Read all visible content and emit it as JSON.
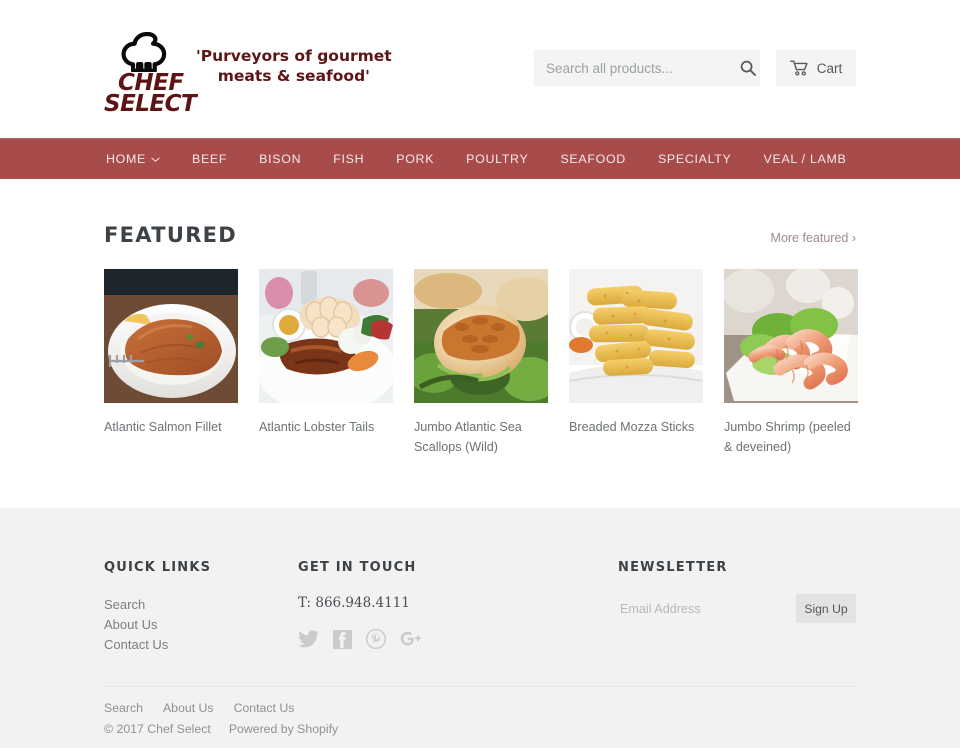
{
  "header": {
    "logo": {
      "line1": "CHEF",
      "line2": "SELECT",
      "tagline_line1": "'Purveyors of gourmet",
      "tagline_line2": "meats & seafood'",
      "hat_icon": "chef-hat-icon",
      "brand_color": "#5e1414"
    },
    "search": {
      "placeholder": "Search all products...",
      "value": "",
      "icon": "search-icon"
    },
    "cart": {
      "label": "Cart",
      "icon": "shopping-cart-icon"
    }
  },
  "nav": {
    "accent_color": "#a84b4b",
    "items": [
      {
        "label": "HOME",
        "has_caret": true,
        "caret_icon": "chevron-down-icon"
      },
      {
        "label": "BEEF",
        "has_caret": false
      },
      {
        "label": "BISON",
        "has_caret": false
      },
      {
        "label": "FISH",
        "has_caret": false
      },
      {
        "label": "PORK",
        "has_caret": false
      },
      {
        "label": "POULTRY",
        "has_caret": false
      },
      {
        "label": "SEAFOOD",
        "has_caret": false
      },
      {
        "label": "SPECIALTY",
        "has_caret": false
      },
      {
        "label": "VEAL / LAMB",
        "has_caret": false
      }
    ]
  },
  "featured": {
    "title": "FEATURED",
    "more_label": "More featured ›",
    "products": [
      {
        "name": "Atlantic Salmon Fillet",
        "image": "salmon-fillet-photo"
      },
      {
        "name": "Atlantic Lobster Tails",
        "image": "lobster-tail-photo"
      },
      {
        "name": "Jumbo Atlantic Sea Scallops (Wild)",
        "image": "sea-scallop-photo"
      },
      {
        "name": "Breaded Mozza Sticks",
        "image": "mozzarella-sticks-photo"
      },
      {
        "name": "Jumbo Shrimp (peeled & deveined)",
        "image": "jumbo-shrimp-photo"
      }
    ]
  },
  "footer": {
    "background": "#f2f2f2",
    "quick_links": {
      "heading": "QUICK LINKS",
      "items": [
        "Search",
        "About Us",
        "Contact Us"
      ]
    },
    "get_in_touch": {
      "heading": "GET IN TOUCH",
      "phone": "T: 866.948.4111",
      "socials": [
        {
          "name": "twitter-icon"
        },
        {
          "name": "facebook-icon"
        },
        {
          "name": "pinterest-icon"
        },
        {
          "name": "google-plus-icon"
        }
      ]
    },
    "newsletter": {
      "heading": "NEWSLETTER",
      "placeholder": "Email Address",
      "value": "",
      "button_label": "Sign Up"
    },
    "bottom": {
      "links": [
        "Search",
        "About Us",
        "Contact Us"
      ],
      "copyright": "© 2017 Chef Select",
      "powered_by": "Powered by Shopify"
    }
  }
}
